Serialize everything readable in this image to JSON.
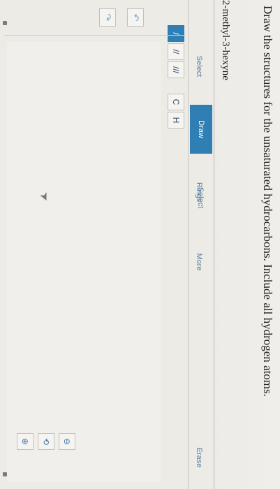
{
  "question": "Draw the structures for the unsaturated hydrocarbons. Include all hydrogen atoms.",
  "compound_name": "2-methyl-3-hexyne",
  "tabs": [
    {
      "label": "Select",
      "active": false
    },
    {
      "label": "Draw",
      "active": true
    },
    {
      "label": "Rings",
      "active": false
    },
    {
      "label": "More",
      "active": false
    },
    {
      "label": "Erase",
      "active": false
    }
  ],
  "bond_tools": [
    "/",
    "//",
    "///"
  ],
  "atom_tools": [
    "C",
    "H"
  ],
  "controls": {
    "undo_icon": "↶",
    "redo_icon": "↷",
    "zoom_in_icon": "⊕",
    "zoom_reset_icon": "⟲",
    "zoom_out_icon": "⊖"
  },
  "colors": {
    "accent": "#2f7fb4",
    "tab_text": "#5c7fa0"
  }
}
